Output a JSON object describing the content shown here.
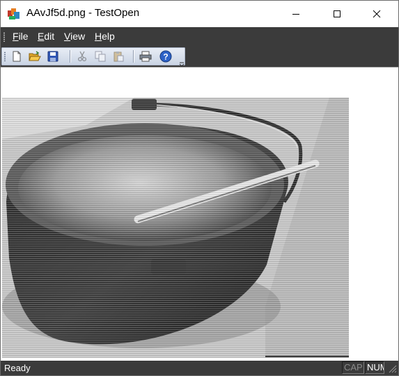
{
  "window": {
    "title": "AAvJf5d.png - TestOpen",
    "app_icon": "mfc-app-icon",
    "controls": [
      "minimize-icon",
      "maximize-icon",
      "close-icon"
    ]
  },
  "menu": {
    "items": [
      {
        "label": "File"
      },
      {
        "label": "Edit"
      },
      {
        "label": "View"
      },
      {
        "label": "Help"
      }
    ]
  },
  "toolbar": {
    "buttons": [
      {
        "icon": "new-document-icon"
      },
      {
        "icon": "open-folder-icon"
      },
      {
        "icon": "save-disk-icon"
      },
      {
        "icon": "cut-scissors-icon"
      },
      {
        "icon": "copy-icon"
      },
      {
        "icon": "paste-icon"
      },
      {
        "icon": "print-icon"
      },
      {
        "icon": "help-icon"
      }
    ]
  },
  "document": {
    "image": "grayscale photo of a large oval metal bucket with a handle and a stirring stick"
  },
  "status": {
    "text": "Ready",
    "cap": "CAP",
    "num": "NUM"
  },
  "colors": {
    "chrome_dark": "#3b3b3b",
    "toolbar_light": "#dde4ef",
    "client_bg": "#ffffff"
  }
}
